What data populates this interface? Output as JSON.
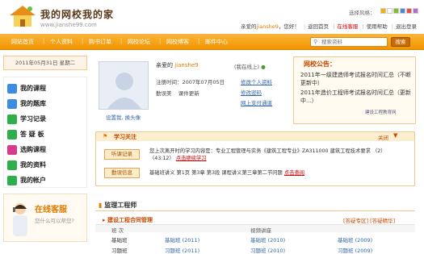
{
  "header": {
    "site_title": "我的网校我的家",
    "site_url": "www.jianshe99.com",
    "style_label": "选择风格：",
    "style_colors": [
      "#f5b000",
      "#ffffff",
      "#7fbf2a",
      "#4a8ad8",
      "#e64c4c",
      "#b36fd6"
    ],
    "greeting_prefix": "亲爱的",
    "username": "jianshe9",
    "greeting_suffix": "，您好！",
    "links": [
      "返回首页",
      "在线客服",
      "使用帮助",
      "退出登录"
    ]
  },
  "nav": {
    "items": [
      "网站首页",
      "个人资料",
      "购书订单",
      "网校论坛",
      "网校博客",
      "邮件中心"
    ],
    "search_placeholder": "搜索资料",
    "search_button": "搜索"
  },
  "sidebar": {
    "date": "2011年05月31日 星期二",
    "menu": [
      {
        "label": "我的课程",
        "color": "#3a8de0"
      },
      {
        "label": "我的题库",
        "color": "#3a8de0"
      },
      {
        "label": "学习记录",
        "color": "#2fae4c"
      },
      {
        "label": "答 疑 板",
        "color": "#2fae4c"
      },
      {
        "label": "选购课程",
        "color": "#d93b8b"
      },
      {
        "label": "我的资料",
        "color": "#2fae4c"
      },
      {
        "label": "我的帐户",
        "color": "#2fae4c"
      }
    ],
    "help_title": "在线客服",
    "help_sub": "您什么可以帮您?"
  },
  "profile": {
    "avatar_link": "设置我, 换头像",
    "greeting_prefix": "亲爱的",
    "username": "jianshe9",
    "online_status": "(我在线上)",
    "reg_label": "注册时间：2007年07月05日",
    "level_label": "勤误美",
    "level_value": "课件更新",
    "links": [
      "修改个人资料",
      "修改密码",
      "网上支付通道"
    ]
  },
  "announcement": {
    "title": "网校公告：",
    "items": [
      "2011年一级建造师考试报名时间汇总（不断更新中）",
      "2011年造价工程师考试报名时间汇总（更新中...）"
    ],
    "logo_text": "建设工程教育网"
  },
  "study": {
    "title": "学习关注",
    "close": "关闭",
    "button1": "听课记录",
    "button2": "勤误信息",
    "line1": "您上次离开时的学习内容是：专业工程管理与实务《建筑工程专业》ZA311000  建筑工程技术要求",
    "line1b": "（2）（43:12）",
    "line1_link": "点击继续学习",
    "line2": "基础班讲义 第1页 第3章 第3段 课程讲义第三章第二节问题",
    "line2_link": "点击查阅"
  },
  "exam": {
    "title": "监理工程师",
    "course_title": "建设工程合同管理",
    "course_links": "[答疑专区]  [答疑精华]",
    "col1": "班 次",
    "col2": "视频讲座",
    "rows": [
      {
        "name": "基础班",
        "videos": [
          "基础班 (2011)",
          "基础班 (2010)",
          "基础班 (2009)"
        ]
      },
      {
        "name": "习题班",
        "videos": [
          "习题班 (2011)",
          "习题班 (2010)",
          "习题班 (2009)"
        ]
      }
    ]
  }
}
